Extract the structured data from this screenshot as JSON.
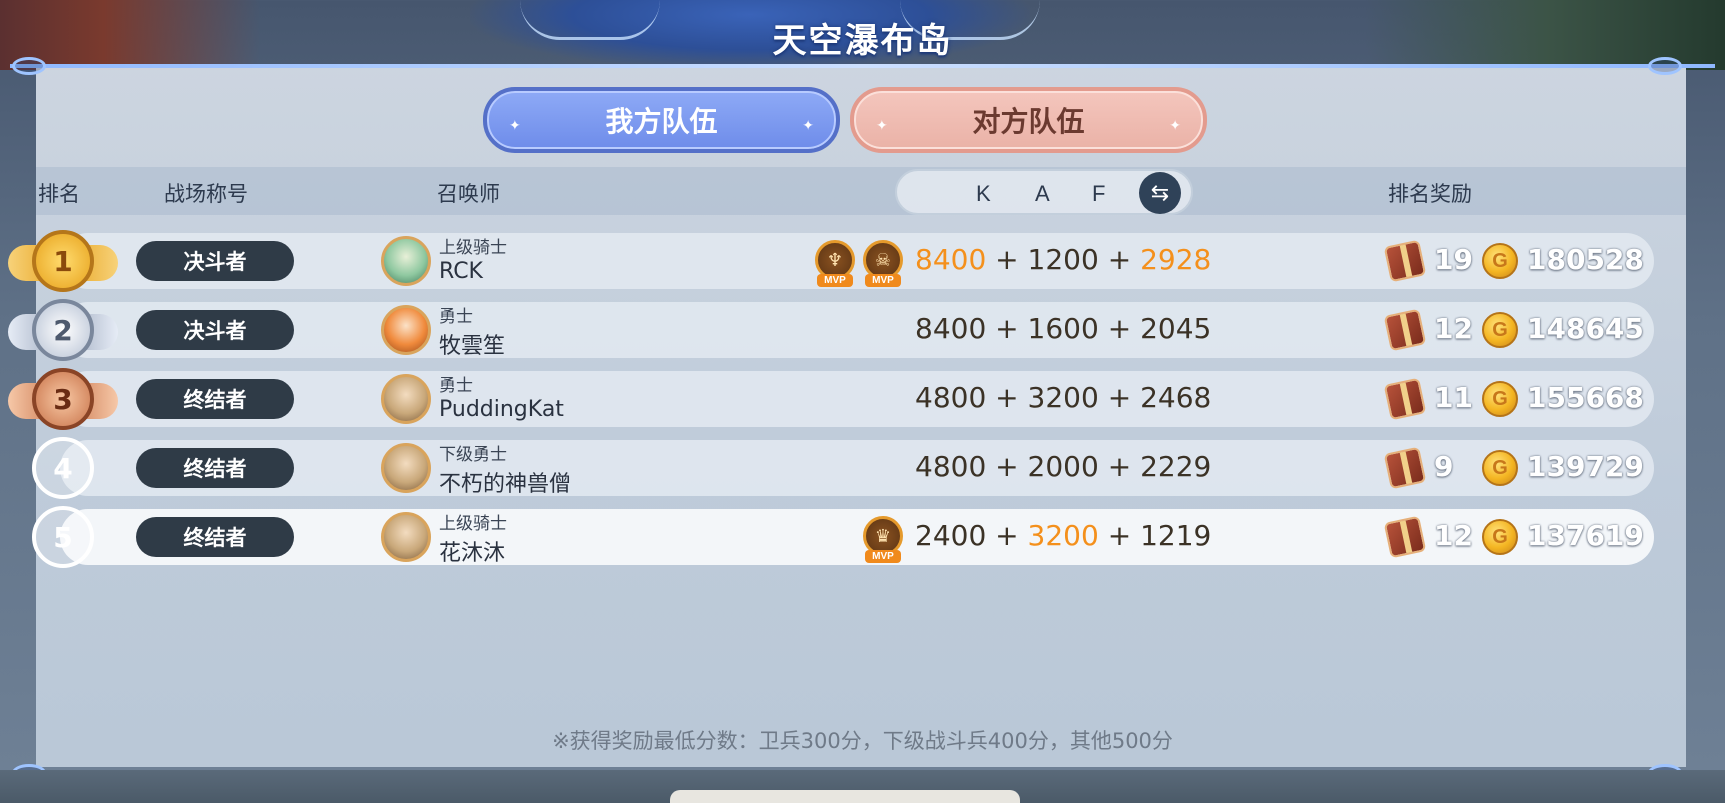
{
  "map": {
    "title": "天空瀑布岛"
  },
  "tabs": {
    "our_team": "我方队伍",
    "enemy_team": "对方队伍",
    "star": "✦"
  },
  "headers": {
    "rank": "排名",
    "title": "战场称号",
    "summoner": "召唤师",
    "k": "K",
    "a": "A",
    "f": "F",
    "reward": "排名奖励"
  },
  "swap_icon": "swap-arrows-icon",
  "rows": [
    {
      "rank": "1",
      "title": "决斗者",
      "level": "上级骑士",
      "name": "RCK",
      "mvp_count": 2,
      "k": "8400",
      "a": "1200",
      "f": "2928",
      "highlight_k": true,
      "highlight_a": false,
      "highlight_f": true,
      "plus1": "+",
      "plus2": "+",
      "chests": "19",
      "gold": "180528"
    },
    {
      "rank": "2",
      "title": "决斗者",
      "level": "勇士",
      "name": "牧雲笙",
      "mvp_count": 0,
      "k": "8400",
      "a": "1600",
      "f": "2045",
      "highlight_k": false,
      "highlight_a": false,
      "highlight_f": false,
      "plus1": "+",
      "plus2": "+",
      "chests": "12",
      "gold": "148645"
    },
    {
      "rank": "3",
      "title": "终结者",
      "level": "勇士",
      "name": "PuddingKat",
      "mvp_count": 0,
      "k": "4800",
      "a": "3200",
      "f": "2468",
      "highlight_k": false,
      "highlight_a": false,
      "highlight_f": false,
      "plus1": "+",
      "plus2": "+",
      "chests": "11",
      "gold": "155668"
    },
    {
      "rank": "4",
      "title": "终结者",
      "level": "下级勇士",
      "name": "不朽的神兽僧",
      "mvp_count": 0,
      "k": "4800",
      "a": "2000",
      "f": "2229",
      "highlight_k": false,
      "highlight_a": false,
      "highlight_f": false,
      "plus1": "+",
      "plus2": "+",
      "chests": "9",
      "gold": "139729"
    },
    {
      "rank": "5",
      "title": "终结者",
      "level": "上级骑士",
      "name": "花沐沐",
      "mvp_count": 1,
      "k": "2400",
      "a": "3200",
      "f": "1219",
      "highlight_k": false,
      "highlight_a": true,
      "highlight_f": false,
      "plus1": "+",
      "plus2": "+",
      "chests": "12",
      "gold": "137619"
    }
  ],
  "mvp_label": "MVP",
  "coin_glyph": "G",
  "footnote": "※获得奖励最低分数：卫兵300分，下级战斗兵400分，其他500分",
  "colors": {
    "highlight": "#f4901c",
    "gold_rank": "#e7a21c",
    "silver_rank": "#9aa6bb",
    "bronze_rank": "#c8734a"
  }
}
